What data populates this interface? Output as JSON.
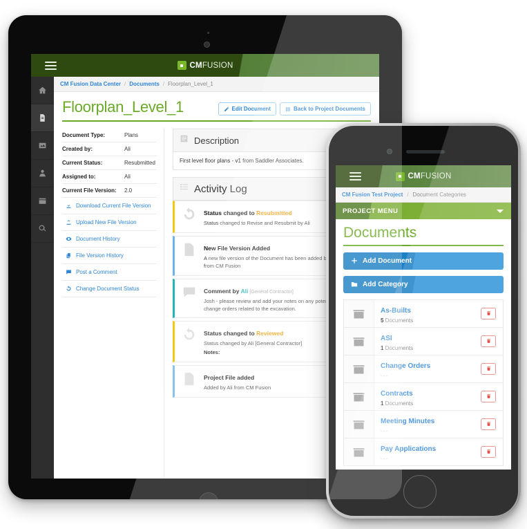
{
  "brand": {
    "name_bold": "CM",
    "name_light": "FUSION",
    "green_dark": "#2e4a10",
    "green_accent": "#6aaa27",
    "blue_link": "#2f86d6",
    "orange_status": "#f0a21c",
    "teal_comment": "#25b6ba",
    "red_delete": "#d9302c"
  },
  "tablet": {
    "topbar": {
      "menu_icon": "hamburger-icon",
      "logo_icon": "cmfusion-logo-icon"
    },
    "sidebar": [
      {
        "icon": "home-icon",
        "name": "home",
        "active": false
      },
      {
        "icon": "document-icon",
        "name": "documents",
        "active": true
      },
      {
        "icon": "image-icon",
        "name": "photos",
        "active": false
      },
      {
        "icon": "user-icon",
        "name": "contacts",
        "active": false
      },
      {
        "icon": "calendar-icon",
        "name": "schedule",
        "active": false
      },
      {
        "icon": "search-icon",
        "name": "search",
        "active": false
      }
    ],
    "breadcrumb": {
      "item1": "CM Fusion Data Center",
      "sep": "/",
      "item2": "Documents",
      "current": "Floorplan_Level_1"
    },
    "page_title": "Floorplan_Level_1",
    "buttons": [
      {
        "label": "Edit Document",
        "icon": "pencil-icon"
      },
      {
        "label": "Back to Project Documents",
        "icon": "list-icon"
      }
    ],
    "meta": [
      {
        "key": "Document Type:",
        "value": "Plans"
      },
      {
        "key": "Created by:",
        "value": "Ali"
      },
      {
        "key": "Current Status:",
        "value": "Resubmitted"
      },
      {
        "key": "Assigned to:",
        "value": "Ali"
      },
      {
        "key": "Current File Version:",
        "value": "2.0"
      }
    ],
    "actions": [
      {
        "label": "Download Current File Version",
        "icon": "download-icon"
      },
      {
        "label": "Upload New File Version",
        "icon": "upload-icon"
      },
      {
        "label": "Document History",
        "icon": "eye-icon"
      },
      {
        "label": "File Version History",
        "icon": "copy-icon"
      },
      {
        "label": "Post a Comment",
        "icon": "comment-icon"
      },
      {
        "label": "Change Document Status",
        "icon": "refresh-icon"
      }
    ],
    "description_card": {
      "title": "Description",
      "icon": "description-icon",
      "text": "First level floor plans - v1 from Saddler Associates."
    },
    "activity_card": {
      "title": "Activity Log",
      "icon": "list-lines-icon"
    },
    "activity_items": [
      {
        "icon": "refresh-icon",
        "accent": "#f5c518",
        "head_prefix": "Status changed to ",
        "head_highlight": "Resubmitted",
        "highlight_class": "hl-orange",
        "head_suffix": "",
        "body": "Status changed to Revise and Resubmit by Ali"
      },
      {
        "icon": "file-icon",
        "accent": "#6cb2eb",
        "head_prefix": "New File Version Added",
        "head_highlight": "",
        "highlight_class": "",
        "head_suffix": "",
        "body": "A new file version of the Document has been added by Ali from CM Fusion"
      },
      {
        "icon": "comment-bubble-icon",
        "accent": "#25b6ba",
        "head_prefix": "Comment by ",
        "head_highlight": "Ali",
        "highlight_class": "hl-teal",
        "head_suffix": " [General Contractor]",
        "body": "Josh - please review and add your notes on any potential change orders related to the excavation."
      },
      {
        "icon": "refresh-icon",
        "accent": "#f5c518",
        "head_prefix": "Status changed to ",
        "head_highlight": "Reviewed",
        "highlight_class": "hl-orange",
        "head_suffix": "",
        "body": "Status changed by Ali [General Contractor]",
        "body_extra": "Notes:"
      },
      {
        "icon": "file-icon",
        "accent": "#6cb2eb",
        "head_prefix": "Project File added",
        "head_highlight": "",
        "highlight_class": "",
        "head_suffix": "",
        "body": "Added by Ali from CM Fusion"
      }
    ]
  },
  "phone": {
    "topbar": {
      "menu_icon": "hamburger-icon",
      "logo_icon": "cmfusion-logo-icon"
    },
    "breadcrumb": {
      "item1": "CM Fusion Test Project",
      "sep": "/",
      "current": "Document Categories"
    },
    "project_menu_label": "PROJECT MENU",
    "page_title": "Documents",
    "buttons": [
      {
        "label": "Add Document",
        "icon": "plus-icon"
      },
      {
        "label": "Add Category",
        "icon": "folder-icon"
      }
    ],
    "categories": [
      {
        "name": "As-Builts",
        "count": "5",
        "count_suffix": " Documents"
      },
      {
        "name": "ASI",
        "count": "1",
        "count_suffix": " Documents"
      },
      {
        "name": "Change Orders",
        "count": "",
        "count_suffix": "---"
      },
      {
        "name": "Contracts",
        "count": "1",
        "count_suffix": " Documents"
      },
      {
        "name": "Meeting Minutes",
        "count": "",
        "count_suffix": "---"
      },
      {
        "name": "Pay Applications",
        "count": "",
        "count_suffix": "---"
      }
    ],
    "delete_icon": "trash-icon"
  }
}
